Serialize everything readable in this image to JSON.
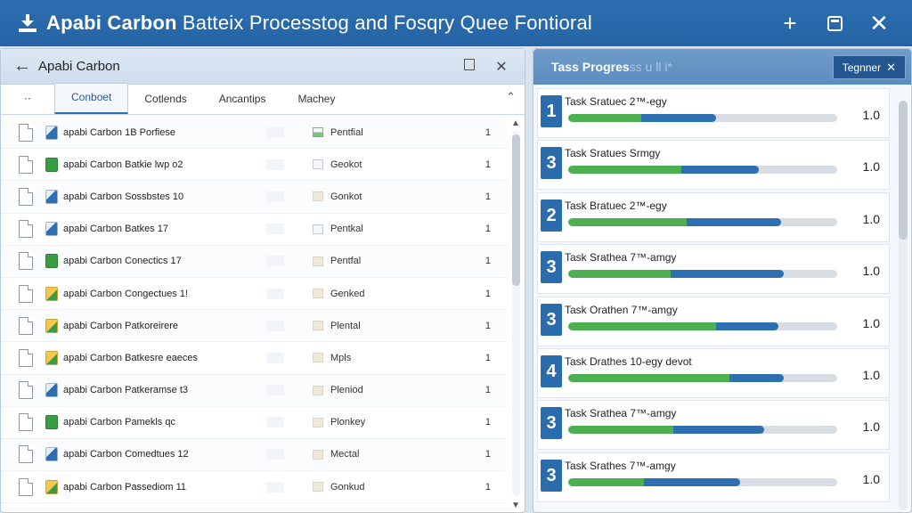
{
  "app": {
    "title_bold": "Apabi Carbon",
    "title_rest": " Batteix Processtog and Fosqry Quee Fontioral",
    "plus_icon": "+",
    "close_icon": "✕"
  },
  "left_pane": {
    "title": "Apabi Carbon",
    "back_icon": "←",
    "close_icon": "✕",
    "tabs_more": "⋅⋅",
    "tabs": [
      "Conboet",
      "Cotlends",
      "Ancantips",
      "Machey"
    ],
    "tabs_caret": "⌃",
    "files": [
      {
        "name": "apabi Carbon 1B Porfiese",
        "type": "blue",
        "status_icon": "green",
        "status": "Pentfial",
        "count": "1"
      },
      {
        "name": "apabi Carbon Batkie lwp o2",
        "type": "green",
        "status_icon": "plain",
        "status": "Geokot",
        "count": "1"
      },
      {
        "name": "apabi Carbon Sossbstes 10",
        "type": "blue",
        "status_icon": "beige",
        "status": "Gonkot",
        "count": "1"
      },
      {
        "name": "apabi Carbon Batkes 17",
        "type": "blue",
        "status_icon": "plain",
        "status": "Pentkal",
        "count": "1"
      },
      {
        "name": "apabi Carbon Conectics 17",
        "type": "green",
        "status_icon": "beige",
        "status": "Pentfal",
        "count": "1"
      },
      {
        "name": "apabi Carbon Congectues 1!",
        "type": "yellow",
        "status_icon": "beige",
        "status": "Genked",
        "count": "1"
      },
      {
        "name": "apabi Carbon Patkoreirere",
        "type": "yellow",
        "status_icon": "beige",
        "status": "Plental",
        "count": "1"
      },
      {
        "name": "apabi Carbon Batkesre eaeces",
        "type": "yellow",
        "status_icon": "beige",
        "status": "Mpls",
        "count": "1"
      },
      {
        "name": "apabi Carbon Patkeramse t3",
        "type": "blue",
        "status_icon": "beige",
        "status": "Pleniod",
        "count": "1"
      },
      {
        "name": "apabi Carbon Pamekls qc",
        "type": "green",
        "status_icon": "beige",
        "status": "Plonkey",
        "count": "1"
      },
      {
        "name": "apabi Carbon Comedtues 12",
        "type": "blue",
        "status_icon": "beige",
        "status": "Mectal",
        "count": "1"
      },
      {
        "name": "apabi Carbon Passediom 11",
        "type": "yellow",
        "status_icon": "beige",
        "status": "Gonkud",
        "count": "1"
      }
    ]
  },
  "right_pane": {
    "title": "Tass Progres",
    "title_faded": "ss u ll i*",
    "button_label": "Tegnner",
    "button_close": "✕",
    "tasks": [
      {
        "num": "1",
        "label": "Task Sratuec 2™-egy",
        "green": 0.27,
        "blue": 0.55,
        "value": "1.0"
      },
      {
        "num": "3",
        "label": "Task Sratues Srmgy",
        "green": 0.42,
        "blue": 0.71,
        "value": "1.0"
      },
      {
        "num": "2",
        "label": "Task Bratuec 2™-egy",
        "green": 0.44,
        "blue": 0.79,
        "value": "1.0"
      },
      {
        "num": "3",
        "label": "Task Srathea 7™-amgy",
        "green": 0.38,
        "blue": 0.8,
        "value": "1.0"
      },
      {
        "num": "3",
        "label": "Task Orathen 7™-amgy",
        "green": 0.55,
        "blue": 0.78,
        "value": "1.0"
      },
      {
        "num": "4",
        "label": "Task Drathes 10-egy devot",
        "green": 0.6,
        "blue": 0.8,
        "value": "1.0"
      },
      {
        "num": "3",
        "label": "Task Srathea 7™-amgy",
        "green": 0.39,
        "blue": 0.73,
        "value": "1.0"
      },
      {
        "num": "3",
        "label": "Task Srathes 7™-amgy",
        "green": 0.28,
        "blue": 0.64,
        "value": "1.0"
      }
    ]
  }
}
